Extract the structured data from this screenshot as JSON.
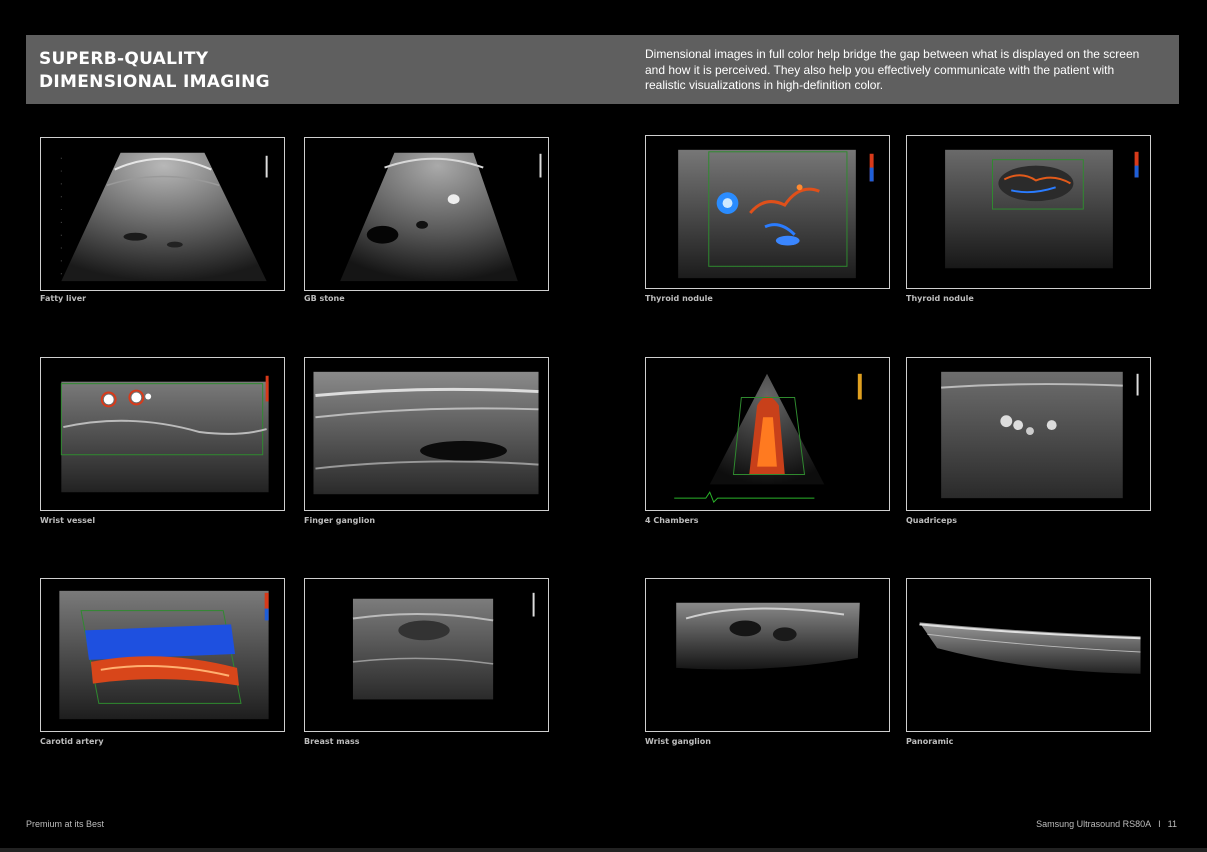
{
  "header": {
    "title_line1": "SUPERB-QUALITY",
    "title_line2": "DIMENSIONAL IMAGING",
    "description": "Dimensional images in full color help bridge the gap between what is displayed on the screen and how it is perceived. They also help you effectively communicate with the patient with realistic visualizations in high-definition color."
  },
  "images": [
    {
      "caption": "Fatty liver"
    },
    {
      "caption": "GB stone"
    },
    {
      "caption": "Thyroid nodule"
    },
    {
      "caption": "Thyroid nodule"
    },
    {
      "caption": "Wrist vessel"
    },
    {
      "caption": "Finger ganglion"
    },
    {
      "caption": "4 Chambers"
    },
    {
      "caption": "Quadriceps"
    },
    {
      "caption": "Carotid artery"
    },
    {
      "caption": "Breast mass"
    },
    {
      "caption": "Wrist ganglion"
    },
    {
      "caption": "Panoramic"
    }
  ],
  "footer": {
    "left": "Premium at its Best",
    "right": "Samsung Ultrasound RS80A",
    "separator": "I",
    "page_number": "11"
  },
  "colors": {
    "header_band": "#5f5f5f",
    "frame_border": "#cfcfcf",
    "doppler_red": "#d83a1a",
    "doppler_blue": "#1e5fd8"
  }
}
